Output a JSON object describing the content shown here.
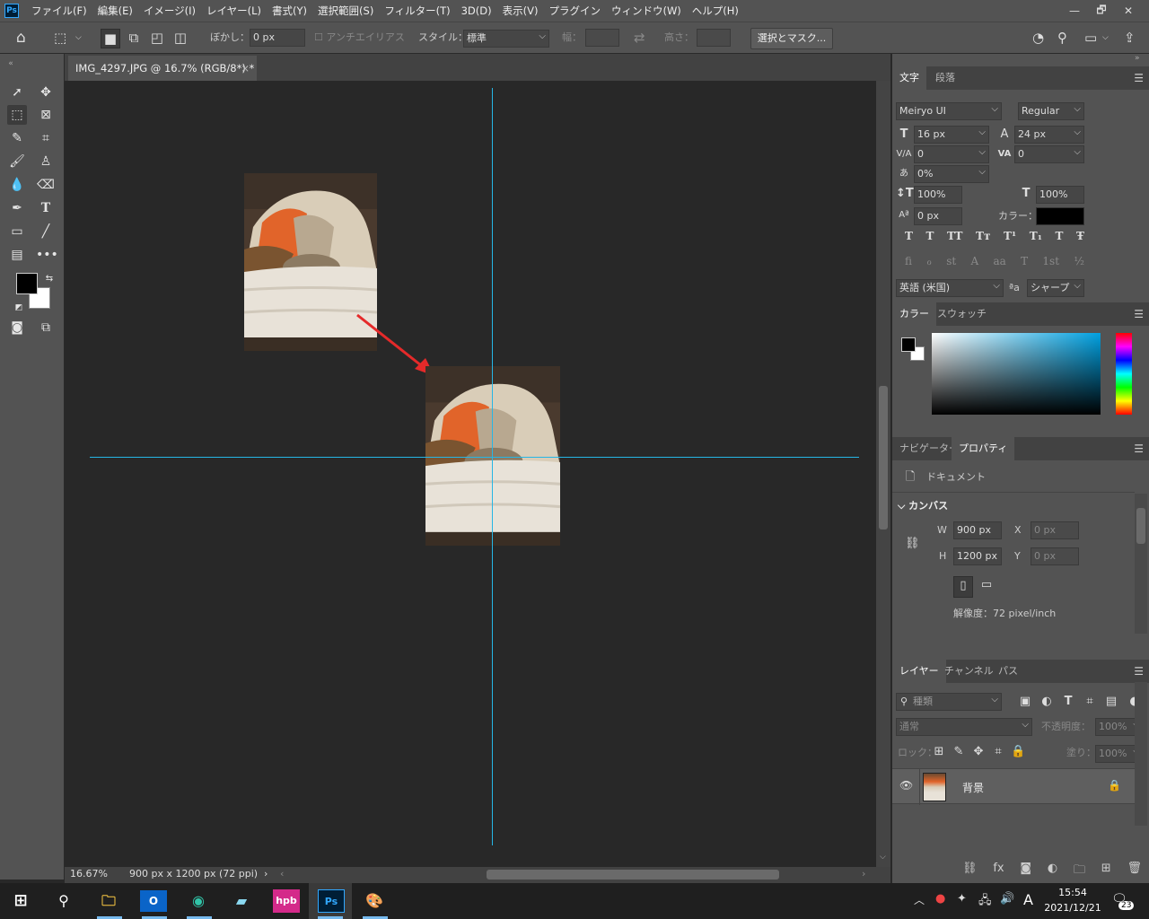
{
  "app": {
    "logo": "Ps"
  },
  "menu": [
    "ファイル(F)",
    "編集(E)",
    "イメージ(I)",
    "レイヤー(L)",
    "書式(Y)",
    "選択範囲(S)",
    "フィルター(T)",
    "3D(D)",
    "表示(V)",
    "プラグイン",
    "ウィンドウ(W)",
    "ヘルプ(H)"
  ],
  "window_controls": {
    "minimize": "—",
    "restore": "🗗",
    "close": "✕"
  },
  "options": {
    "feather_label": "ぼかし：",
    "feather_value": "0 px",
    "antialias_label": "アンチエイリアス",
    "style_label": "スタイル：",
    "style_value": "標準",
    "width_label": "幅：",
    "height_label": "高さ：",
    "select_mask_button": "選択とマスク..."
  },
  "document": {
    "tab_title": "IMG_4297.JPG @ 16.7% (RGB/8*) *",
    "tab_close": "×",
    "zoom": "16.67%",
    "info": "900 px x 1200 px (72 ppi)"
  },
  "character_panel": {
    "tabs": [
      "文字",
      "段落"
    ],
    "font_family": "Meiryo UI",
    "font_style": "Regular",
    "font_size": "16 px",
    "leading": "24 px",
    "kerning": "0",
    "tracking": "0",
    "tsume": "0%",
    "vertical_scale": "100%",
    "horizontal_scale": "100%",
    "baseline_shift": "0 px",
    "color_label": "カラー：",
    "style_buttons": [
      "T",
      "T",
      "TT",
      "Tт",
      "T¹",
      "T₁",
      "T",
      "Ŧ"
    ],
    "opentype_buttons": [
      "fi",
      "ℴ",
      "st",
      "A",
      "aa",
      "T",
      "1st",
      "½"
    ],
    "language": "英語 (米国)",
    "aa_label": "ªa",
    "antialias": "シャープ"
  },
  "color_panel": {
    "tabs": [
      "カラー",
      "スウォッチ"
    ]
  },
  "properties_panel": {
    "tabs": [
      "ナビゲーター",
      "プロパティ"
    ],
    "doc_label": "ドキュメント",
    "section": "カンバス",
    "w_label": "W",
    "w_value": "900 px",
    "h_label": "H",
    "h_value": "1200 px",
    "x_label": "X",
    "x_value": "0 px",
    "y_label": "Y",
    "y_value": "0 px",
    "resolution": "解像度：72 pixel/inch"
  },
  "layers_panel": {
    "tabs": [
      "レイヤー",
      "チャンネル",
      "パス"
    ],
    "filter_placeholder": "種類",
    "blend_mode": "通常",
    "opacity_label": "不透明度：",
    "opacity_value": "100%",
    "lock_label": "ロック：",
    "fill_label": "塗り：",
    "fill_value": "100%",
    "layers": [
      {
        "name": "背景",
        "visible": true,
        "locked": true
      }
    ]
  },
  "taskbar": {
    "time": "15:54",
    "date": "2021/12/21",
    "ime": "A",
    "notification_count": "23",
    "apps": [
      "explorer",
      "outlook",
      "edge",
      "app4",
      "hpb",
      "photoshop",
      "paint"
    ]
  },
  "colors": {
    "guide": "#26b6e5",
    "arrow": "#e52a2a",
    "foreground": "#000000",
    "background": "#ffffff"
  }
}
